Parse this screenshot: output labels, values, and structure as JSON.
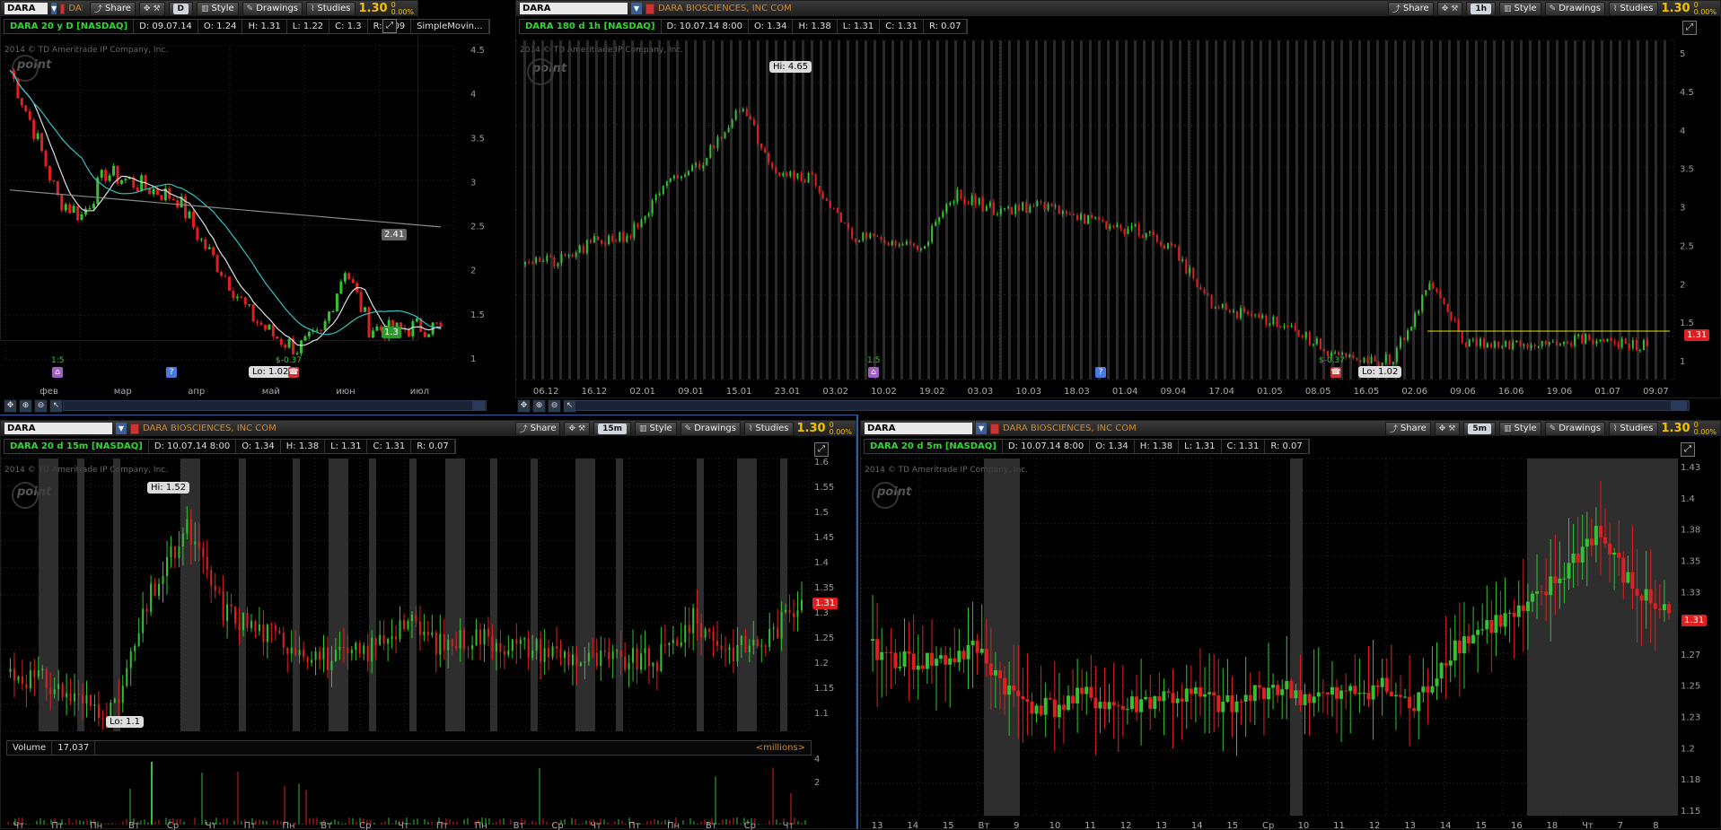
{
  "panels": {
    "top_left": {
      "symbol": "DARA",
      "company": "DARA ...",
      "aggregation": "D",
      "buttons": {
        "share": "Share",
        "style": "Style",
        "drawings": "Drawings",
        "studies": "Studies"
      },
      "last_price": "1.30",
      "change_top": "0",
      "change_pct": "0.00%",
      "info": {
        "title": "DARA 20 y D [NASDAQ]",
        "date": "D: 09.07.14",
        "open": "O: 1.24",
        "high": "H: 1.31",
        "low": "L: 1.22",
        "close": "C: 1.3",
        "range": "R: 0.09",
        "study": "SimpleMovin..."
      },
      "copyright": "2014 © TD Ameritrade IP Company, Inc.",
      "logo": "point",
      "y_ticks": [
        "4.5",
        "4",
        "3.5",
        "3",
        "2.5",
        "2",
        "1.5",
        "1"
      ],
      "x_ticks": [
        "фев",
        "мар",
        "апр",
        "май",
        "июн",
        "июл"
      ],
      "sma_tag": "2.41",
      "price_tag": "1.3",
      "low_label": "Lo: 1.02",
      "events": {
        "split": "1:5",
        "dividend": "$-0.37"
      }
    },
    "top_right": {
      "symbol": "DARA",
      "company": "DARA BIOSCIENCES, INC COM",
      "aggregation": "1h",
      "buttons": {
        "share": "Share",
        "style": "Style",
        "drawings": "Drawings",
        "studies": "Studies"
      },
      "last_price": "1.30",
      "change_top": "0",
      "change_pct": "0.00%",
      "info": {
        "title": "DARA 180 d 1h [NASDAQ]",
        "date": "D: 10.07.14 8:00",
        "open": "O: 1.34",
        "high": "H: 1.38",
        "low": "L: 1.31",
        "close": "C: 1.31",
        "range": "R: 0.07"
      },
      "copyright": "2014 © TD Ameritrade IP Company, Inc.",
      "logo": "point",
      "y_ticks": [
        "5",
        "4.5",
        "4",
        "3.5",
        "3",
        "2.5",
        "2",
        "1.5",
        "1"
      ],
      "x_ticks": [
        "06.12",
        "16.12",
        "02.01",
        "09.01",
        "15.01",
        "23.01",
        "03.02",
        "10.02",
        "19.02",
        "03.03",
        "10.03",
        "18.03",
        "01.04",
        "09.04",
        "17.04",
        "01.05",
        "08.05",
        "16.05",
        "02.06",
        "09.06",
        "16.06",
        "19.06",
        "01.07",
        "09.07"
      ],
      "high_label": "Hi: 4.65",
      "low_label": "Lo: 1.02",
      "price_tag": "1.31",
      "events": {
        "split": "1:5",
        "dividend": "$-0.37"
      }
    },
    "bottom_left": {
      "symbol": "DARA",
      "company": "DARA BIOSCIENCES, INC COM",
      "aggregation": "15m",
      "buttons": {
        "share": "Share",
        "style": "Style",
        "drawings": "Drawings",
        "studies": "Studies"
      },
      "last_price": "1.30",
      "change_top": "0",
      "change_pct": "0.00%",
      "info": {
        "title": "DARA 20 d 15m [NASDAQ]",
        "date": "D: 10.07.14 8:00",
        "open": "O: 1.34",
        "high": "H: 1.38",
        "low": "L: 1.31",
        "close": "C: 1.31",
        "range": "R: 0.07"
      },
      "copyright": "2014 © TD Ameritrade IP Company, Inc.",
      "logo": "point",
      "y_ticks": [
        "1.6",
        "1.55",
        "1.5",
        "1.45",
        "1.4",
        "1.35",
        "1.3",
        "1.25",
        "1.2",
        "1.15",
        "1.1"
      ],
      "high_label": "Hi: 1.52",
      "low_label": "Lo: 1.1",
      "price_tag": "1.31",
      "volume": {
        "label": "Volume",
        "value": "17,037",
        "unit": "<millions>",
        "y_ticks": [
          "4",
          "2"
        ]
      },
      "x_ticks": [
        "Чт",
        "Пт",
        "Пн",
        "Вт",
        "Ср",
        "Чт",
        "Пт",
        "Пн",
        "Вт",
        "Ср",
        "Чт",
        "Пт",
        "Пн",
        "Вт",
        "Ср",
        "Чт",
        "Пт",
        "Пн",
        "Вт",
        "Ср",
        "Чт"
      ]
    },
    "bottom_right": {
      "symbol": "DARA",
      "company": "DARA BIOSCIENCES, INC COM",
      "aggregation": "5m",
      "buttons": {
        "share": "Share",
        "style": "Style",
        "drawings": "Drawings",
        "studies": "Studies"
      },
      "last_price": "1.30",
      "change_top": "0",
      "change_pct": "0.00%",
      "info": {
        "title": "DARA 20 d 5m [NASDAQ]",
        "date": "D: 10.07.14 8:00",
        "open": "O: 1.34",
        "high": "H: 1.38",
        "low": "L: 1.31",
        "close": "C: 1.31",
        "range": "R: 0.07"
      },
      "copyright": "2014 © TD Ameritrade IP Company, Inc.",
      "logo": "point",
      "y_ticks": [
        "1.43",
        "1.4",
        "1.38",
        "1.35",
        "1.33",
        "1.3",
        "1.27",
        "1.25",
        "1.23",
        "1.2",
        "1.18",
        "1.15"
      ],
      "x_ticks": [
        "13",
        "14",
        "15",
        "Вт",
        "9",
        "10",
        "11",
        "12",
        "13",
        "14",
        "15",
        "Ср",
        "10",
        "11",
        "12",
        "13",
        "14",
        "15",
        "16",
        "18",
        "Чт",
        "7",
        "8"
      ],
      "price_tag": "1.31"
    }
  },
  "colors": {
    "up": "#34c234",
    "down": "#e02020",
    "sma1": "#e0e0e0",
    "sma2": "#2fc4c4",
    "sma3": "#888888",
    "session_shade": "#3a3a3a",
    "resistance": "#e6e600"
  }
}
